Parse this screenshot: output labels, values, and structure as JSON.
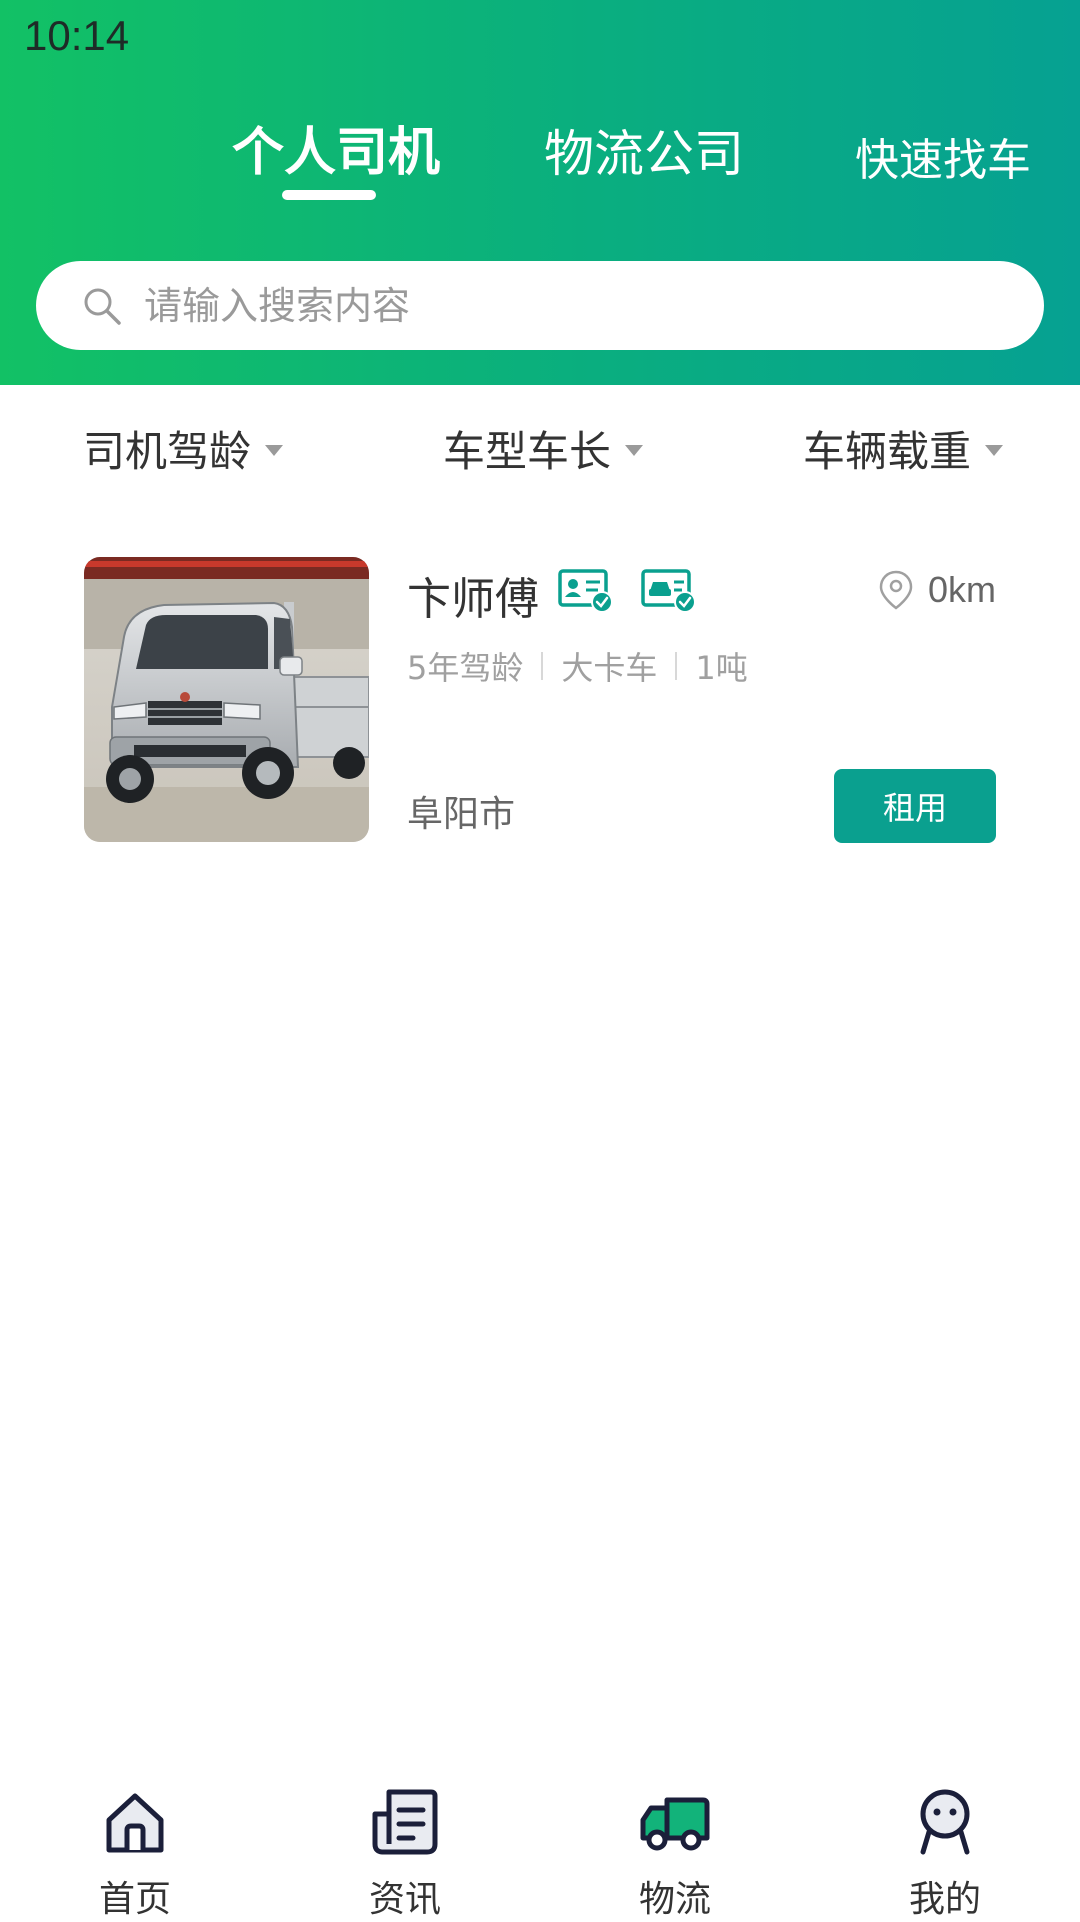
{
  "status_bar": {
    "time": "10:14"
  },
  "header": {
    "tabs": [
      {
        "label": "个人司机",
        "active": true
      },
      {
        "label": "物流公司",
        "active": false
      },
      {
        "label": "快速找车",
        "active": false
      }
    ],
    "search": {
      "placeholder": "请输入搜索内容",
      "icon": "search-icon"
    },
    "gradient_colors": [
      "#12c165",
      "#06a192"
    ]
  },
  "filters": [
    {
      "label": "司机驾龄",
      "icon": "caret-down-icon"
    },
    {
      "label": "车型车长",
      "icon": "caret-down-icon"
    },
    {
      "label": "车辆载重",
      "icon": "caret-down-icon"
    }
  ],
  "drivers": [
    {
      "name": "卞师傅",
      "badges": [
        "license-verified-icon",
        "vehicle-verified-icon"
      ],
      "distance": "0km",
      "experience": "5年驾龄",
      "vehicle_type": "大卡车",
      "load": "1吨",
      "city": "阜阳市",
      "action_label": "租用",
      "photo": "truck-photo"
    }
  ],
  "bottom_nav": [
    {
      "label": "首页",
      "icon": "home-icon",
      "active": false
    },
    {
      "label": "资讯",
      "icon": "news-icon",
      "active": false
    },
    {
      "label": "物流",
      "icon": "truck-icon",
      "active": true
    },
    {
      "label": "我的",
      "icon": "profile-icon",
      "active": false
    }
  ],
  "colors": {
    "accent": "#0aa08f",
    "brand_green": "#12c165"
  }
}
